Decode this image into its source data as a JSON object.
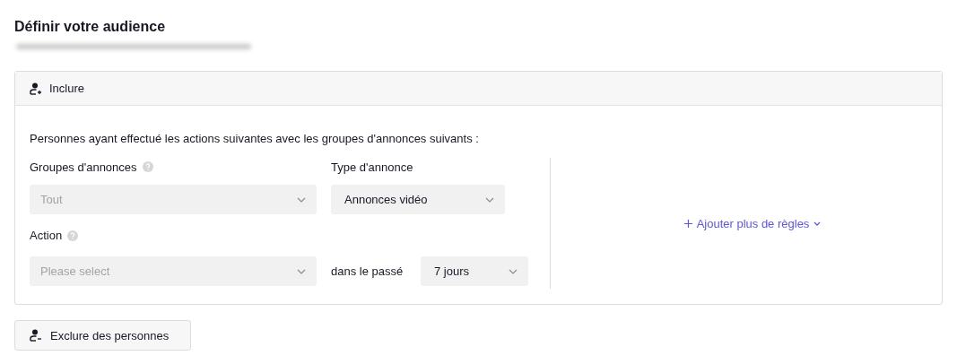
{
  "title": "Définir votre audience",
  "include_panel": {
    "header": "Inclure",
    "description": "Personnes ayant effectué les actions suivantes avec les groupes d'annonces suivants :",
    "ad_groups": {
      "label": "Groupes d'annonces",
      "has_help": true,
      "value": "Tout",
      "disabled": true
    },
    "ad_type": {
      "label": "Type d'annonce",
      "value": "Annonces vidéo",
      "disabled": false
    },
    "action": {
      "label": "Action",
      "has_help": true,
      "placeholder": "Please select"
    },
    "period_label": "dans le passé",
    "period": {
      "value": "7 jours",
      "disabled": false
    },
    "add_rules_link": "Ajouter plus de règles"
  },
  "exclude_button": "Exclure des personnes"
}
